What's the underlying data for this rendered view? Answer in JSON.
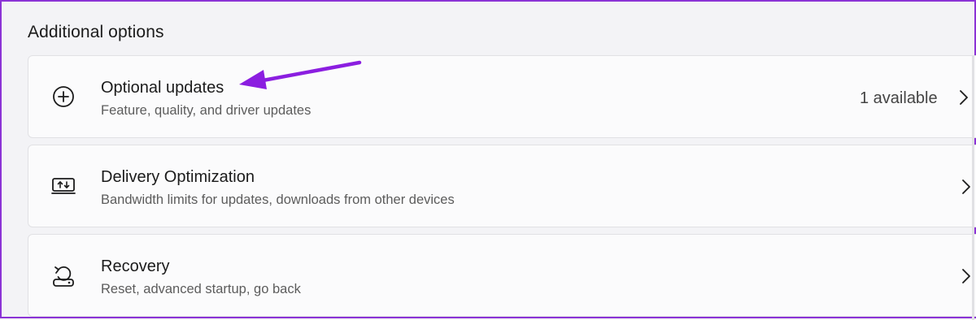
{
  "section": {
    "title": "Additional options"
  },
  "items": [
    {
      "title": "Optional updates",
      "subtitle": "Feature, quality, and driver updates",
      "status": "1 available",
      "icon": "add-circle-icon"
    },
    {
      "title": "Delivery Optimization",
      "subtitle": "Bandwidth limits for updates, downloads from other devices",
      "icon": "delivery-optimization-icon"
    },
    {
      "title": "Recovery",
      "subtitle": "Reset, advanced startup, go back",
      "icon": "recovery-icon"
    }
  ],
  "colors": {
    "background": "#f3f3f6",
    "card": "#fbfbfc",
    "annotation_arrow": "#8b1ee0",
    "border_accent": "#8b33d6"
  }
}
